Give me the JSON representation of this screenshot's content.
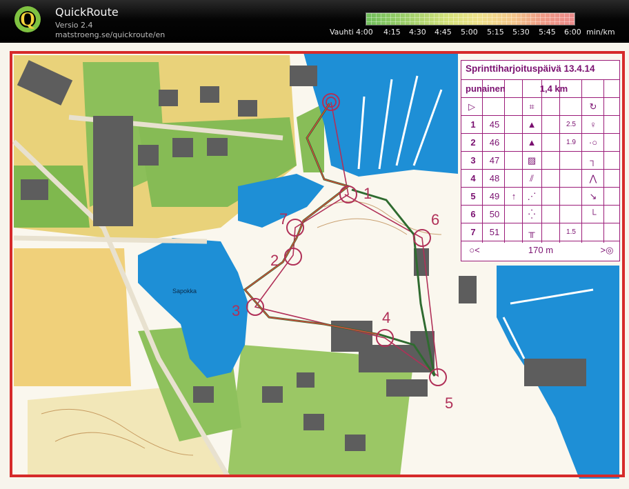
{
  "app": {
    "title": "QuickRoute",
    "version": "Versio 2.4",
    "url": "matstroeng.se/quickroute/en"
  },
  "pace_scale": {
    "label": "Vauhti",
    "ticks": [
      "4:00",
      "4:15",
      "4:30",
      "4:45",
      "5:00",
      "5:15",
      "5:30",
      "5:45",
      "6:00"
    ],
    "unit": "min/km",
    "colors": [
      "#6fbf5a",
      "#9fd06a",
      "#d7e27a",
      "#f0e18a",
      "#f4c88a",
      "#f09a86",
      "#ec8a8a"
    ]
  },
  "map": {
    "lake_label": "Sapokka",
    "control_numbers": [
      "1",
      "2",
      "3",
      "4",
      "5",
      "6",
      "7"
    ],
    "colors": {
      "water": "#1e8fd6",
      "forest": "#6fb34a",
      "open": "#f2c04a",
      "building": "#5a5a5a",
      "course": "#b03058",
      "route": "#2f6b30",
      "frame": "#d62a2a"
    }
  },
  "legend": {
    "title": "Sprinttiharjoituspäivä 13.4.14",
    "course": "punainen",
    "length": "1,4 km",
    "finish_distance": "170 m",
    "rows": [
      {
        "num": "1",
        "code": "45",
        "symbol": "triangle",
        "extra": "2.5"
      },
      {
        "num": "2",
        "code": "46",
        "symbol": "triangle",
        "extra": "1.9"
      },
      {
        "num": "3",
        "code": "47",
        "symbol": "hatched-square",
        "extra": ""
      },
      {
        "num": "4",
        "code": "48",
        "symbol": "stairs",
        "extra": ""
      },
      {
        "num": "5",
        "code": "49",
        "symbol": "stairs",
        "extra": ""
      },
      {
        "num": "6",
        "code": "50",
        "symbol": "dots",
        "extra": ""
      },
      {
        "num": "7",
        "code": "51",
        "symbol": "fence",
        "extra": "1.5"
      }
    ]
  }
}
